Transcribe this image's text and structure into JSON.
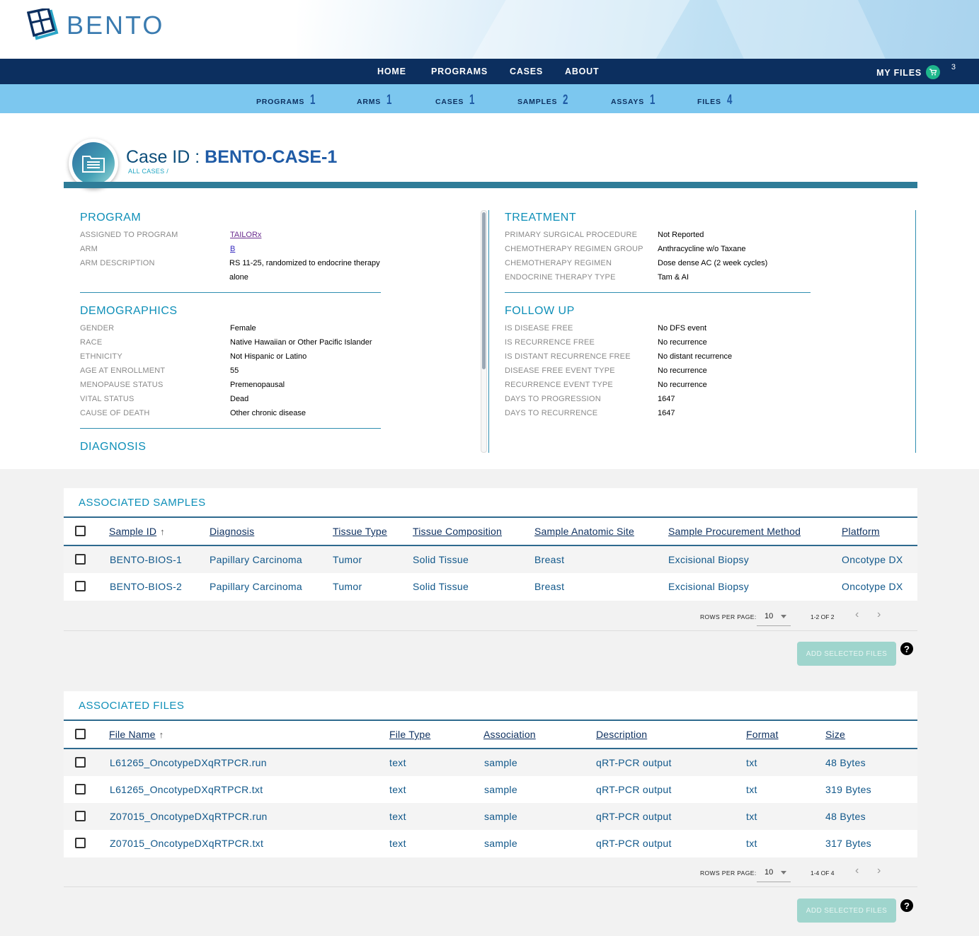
{
  "brand": {
    "name": "BENTO"
  },
  "nav": {
    "items": [
      {
        "label": "HOME"
      },
      {
        "label": "PROGRAMS"
      },
      {
        "label": "CASES"
      },
      {
        "label": "ABOUT"
      }
    ],
    "my_files_label": "MY FILES",
    "cart_count": "3"
  },
  "stats": [
    {
      "label": "PROGRAMS",
      "value": "1"
    },
    {
      "label": "ARMS",
      "value": "1"
    },
    {
      "label": "CASES",
      "value": "1"
    },
    {
      "label": "SAMPLES",
      "value": "2"
    },
    {
      "label": "ASSAYS",
      "value": "1"
    },
    {
      "label": "FILES",
      "value": "4"
    }
  ],
  "case": {
    "title_label": "Case ID :",
    "id": "BENTO-CASE-1",
    "breadcrumb": "ALL CASES /"
  },
  "program": {
    "title": "PROGRAM",
    "rows": [
      {
        "k": "ASSIGNED TO PROGRAM",
        "v": "TAILORx"
      },
      {
        "k": "ARM",
        "v": "B"
      },
      {
        "k": "ARM DESCRIPTION",
        "v": "RS 11-25, randomized to endocrine therapy alone"
      }
    ]
  },
  "demographics": {
    "title": "DEMOGRAPHICS",
    "rows": [
      {
        "k": "GENDER",
        "v": "Female"
      },
      {
        "k": "RACE",
        "v": "Native Hawaiian or Other Pacific Islander"
      },
      {
        "k": "ETHNICITY",
        "v": "Not Hispanic or Latino"
      },
      {
        "k": "AGE AT ENROLLMENT",
        "v": "55"
      },
      {
        "k": "MENOPAUSE STATUS",
        "v": "Premenopausal"
      },
      {
        "k": "VITAL STATUS",
        "v": "Dead"
      },
      {
        "k": "CAUSE OF DEATH",
        "v": "Other chronic disease"
      }
    ]
  },
  "diagnosis": {
    "title": "DIAGNOSIS"
  },
  "treatment": {
    "title": "TREATMENT",
    "rows": [
      {
        "k": "PRIMARY SURGICAL PROCEDURE",
        "v": "Not Reported"
      },
      {
        "k": "CHEMOTHERAPY REGIMEN GROUP",
        "v": "Anthracycline w/o Taxane"
      },
      {
        "k": "CHEMOTHERAPY REGIMEN",
        "v": "Dose dense AC (2 week cycles)"
      },
      {
        "k": "ENDOCRINE THERAPY TYPE",
        "v": "Tam & AI"
      }
    ]
  },
  "follow_up": {
    "title": "FOLLOW UP",
    "rows": [
      {
        "k": "IS DISEASE FREE",
        "v": "No DFS event"
      },
      {
        "k": "IS RECURRENCE FREE",
        "v": "No recurrence"
      },
      {
        "k": "IS DISTANT RECURRENCE FREE",
        "v": "No distant recurrence"
      },
      {
        "k": "DISEASE FREE EVENT TYPE",
        "v": "No recurrence"
      },
      {
        "k": "RECURRENCE EVENT TYPE",
        "v": "No recurrence"
      },
      {
        "k": "DAYS TO PROGRESSION",
        "v": "1647"
      },
      {
        "k": "DAYS TO RECURRENCE",
        "v": "1647"
      }
    ]
  },
  "samples": {
    "title": "ASSOCIATED SAMPLES",
    "columns": [
      "Sample ID",
      "Diagnosis",
      "Tissue Type",
      "Tissue Composition",
      "Sample Anatomic Site",
      "Sample Procurement Method",
      "Platform"
    ],
    "rows": [
      [
        "BENTO-BIOS-1",
        "Papillary Carcinoma",
        "Tumor",
        "Solid Tissue",
        "Breast",
        "Excisional Biopsy",
        "Oncotype DX"
      ],
      [
        "BENTO-BIOS-2",
        "Papillary Carcinoma",
        "Tumor",
        "Solid Tissue",
        "Breast",
        "Excisional Biopsy",
        "Oncotype DX"
      ]
    ],
    "rows_per_page_label": "ROWS PER PAGE:",
    "rows_per_page": "10",
    "count": "1-2 OF 2",
    "add_button": "ADD SELECTED FILES"
  },
  "files": {
    "title": "ASSOCIATED FILES",
    "columns": [
      "File Name",
      "File Type",
      "Association",
      "Description",
      "Format",
      "Size"
    ],
    "rows": [
      [
        "L61265_OncotypeDXqRTPCR.run",
        "text",
        "sample",
        "qRT-PCR output",
        "txt",
        "48 Bytes"
      ],
      [
        "L61265_OncotypeDXqRTPCR.txt",
        "text",
        "sample",
        "qRT-PCR output",
        "txt",
        "319 Bytes"
      ],
      [
        "Z07015_OncotypeDXqRTPCR.run",
        "text",
        "sample",
        "qRT-PCR output",
        "txt",
        "48 Bytes"
      ],
      [
        "Z07015_OncotypeDXqRTPCR.txt",
        "text",
        "sample",
        "qRT-PCR output",
        "txt",
        "317 Bytes"
      ]
    ],
    "rows_per_page_label": "ROWS PER PAGE:",
    "rows_per_page": "10",
    "count": "1-4 OF 4",
    "add_button": "ADD SELECTED FILES"
  },
  "help_glyph": "?",
  "colors": {
    "nav": "#0c2f5f",
    "stats_bar": "#7cc7ef",
    "accent": "#0e8fb8",
    "button": "#9fd5cd"
  }
}
